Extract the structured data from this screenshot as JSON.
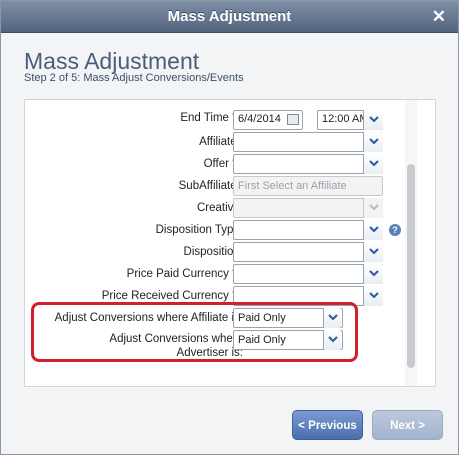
{
  "dialog": {
    "title": "Mass Adjustment",
    "close_glyph": "✕"
  },
  "page": {
    "heading": "Mass Adjustment",
    "step": "Step 2 of 5: Mass Adjust Conversions/Events"
  },
  "form": {
    "end_time_label": "End Time * :",
    "end_date_value": "6/4/2014",
    "end_time_value": "12:00 AM",
    "affiliate_label": "Affiliate :",
    "offer_label": "Offer * :",
    "subaffiliate_label": "SubAffiliate :",
    "subaffiliate_placeholder": "First Select an Affiliate",
    "creative_label": "Creative:",
    "disposition_type_label": "Disposition Type:",
    "disposition_label": "Disposition:",
    "price_paid_currency_label": "Price Paid Currency * :",
    "price_received_currency_label": "Price Received Currency * :",
    "adjust_affiliate_label": "Adjust Conversions where Affiliate is:",
    "adjust_affiliate_value": "Paid Only",
    "adjust_advertiser_label_1": "Adjust Conversions where",
    "adjust_advertiser_label_2": "Advertiser is:",
    "adjust_advertiser_value": "Paid Only",
    "help_glyph": "?"
  },
  "buttons": {
    "previous": "< Previous",
    "next": "Next >"
  },
  "colors": {
    "highlight": "#d0202b",
    "titlebar": "#52647d",
    "accent": "#4b6eac"
  }
}
